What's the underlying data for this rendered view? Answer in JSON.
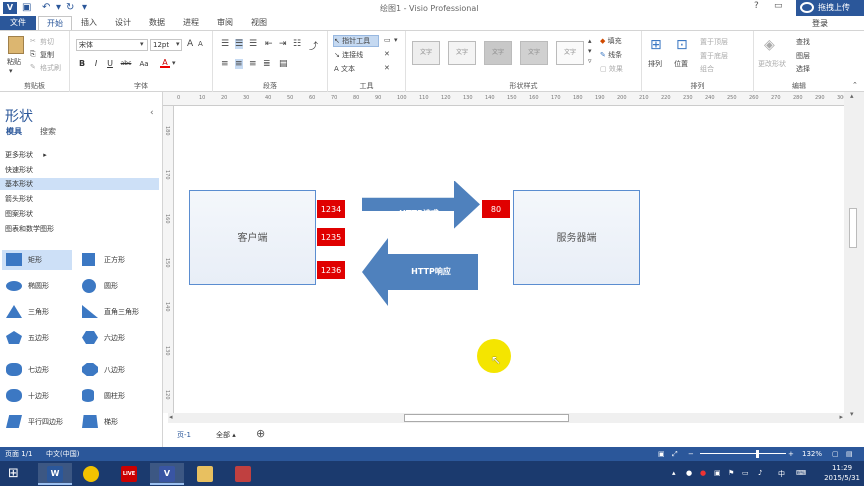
{
  "app": {
    "title": "绘图1 - Visio Professional",
    "icon_label": "V",
    "undo_icon": "undo-icon",
    "redo_icon": "redo-icon",
    "save_icon": "save-icon"
  },
  "window_controls": {
    "help": "?",
    "restore": "▭",
    "minimize": "—",
    "maximize": "□",
    "close": "✕"
  },
  "tabs": [
    "文件",
    "开始",
    "插入",
    "设计",
    "数据",
    "进程",
    "审阅",
    "视图"
  ],
  "active_tab": "开始",
  "share_label": "拖拽上传",
  "login_label": "登录",
  "ribbon": {
    "clipboard": {
      "label": "剪贴板",
      "paste": "粘贴",
      "cut": "剪切",
      "copy": "复制",
      "format_painter": "格式刷"
    },
    "font": {
      "label": "字体",
      "font_name": "宋体",
      "font_size": "12pt",
      "bold": "B",
      "italic": "I",
      "underline": "U",
      "strike": "abc",
      "size_up": "A",
      "size_down": "A",
      "aa": "Aa",
      "color": "A"
    },
    "paragraph": {
      "label": "段落"
    },
    "tools": {
      "label": "工具",
      "pointer": "指针工具",
      "connector": "连接线",
      "text": "文本"
    },
    "shape_styles": {
      "label": "形状样式",
      "swatch_text": "文字",
      "fill": "填充",
      "line": "线条",
      "effects": "效果"
    },
    "arrange": {
      "label": "排列",
      "arrange": "排列",
      "position": "位置",
      "bring_front": "置于顶层",
      "send_back": "置于底层",
      "group": "组合"
    },
    "editing": {
      "label": "编辑",
      "change_shape": "更改形状",
      "find": "查找",
      "layers": "图层",
      "select": "选择"
    }
  },
  "shapes_panel": {
    "title": "形状",
    "tabs": [
      "模具",
      "搜索"
    ],
    "categories": [
      "更多形状",
      "快速形状",
      "基本形状",
      "箭头形状",
      "图案形状",
      "图表和数学图形"
    ],
    "selected_category": "基本形状",
    "shapes": [
      "矩形",
      "正方形",
      "椭圆形",
      "圆形",
      "三角形",
      "直角三角形",
      "五边形",
      "六边形",
      "七边形",
      "八边形",
      "十边形",
      "圆柱形",
      "平行四边形",
      "梯形"
    ]
  },
  "ruler": {
    "top_ticks": [
      "0",
      "10",
      "20",
      "30",
      "40",
      "50",
      "60",
      "70",
      "80",
      "90",
      "100",
      "110",
      "120",
      "130",
      "140",
      "150",
      "160",
      "170",
      "180",
      "190",
      "200",
      "210",
      "220",
      "230",
      "240",
      "250",
      "260",
      "270",
      "280",
      "290",
      "300"
    ],
    "left_ticks": [
      "180",
      "170",
      "160",
      "150",
      "140",
      "130",
      "120"
    ]
  },
  "diagram": {
    "client_label": "客户端",
    "server_label": "服务器端",
    "client_ports": [
      "1234",
      "1235",
      "1236"
    ],
    "server_port": "80",
    "request_label": "HTTP请求",
    "response_label": "HTTP响应",
    "arrow_color": "#4f81bd",
    "port_color": "#e00000"
  },
  "pages": {
    "page1": "页-1",
    "all": "全部",
    "add_icon": "add-page-icon"
  },
  "status": {
    "page": "页面 1/1",
    "language": "中文(中国)",
    "zoom": "132%"
  },
  "taskbar": {
    "apps": [
      "Word",
      "Chrome",
      "Recorder",
      "Visio",
      "Explorer",
      "Paint"
    ],
    "time": "11:29",
    "date": "2015/5/31",
    "ime": "中"
  }
}
